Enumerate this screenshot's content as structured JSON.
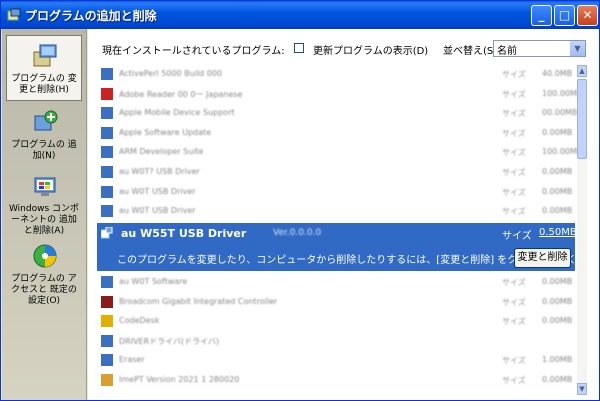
{
  "window": {
    "title": "プログラムの追加と削除",
    "buttons": {
      "minimize": "_",
      "maximize": "□",
      "close": "✕"
    }
  },
  "sidebar": {
    "items": [
      {
        "label": "プログラムの 変更と削除(H)",
        "icon": "change-remove-programs-icon"
      },
      {
        "label": "プログラムの 追加(N)",
        "icon": "add-programs-icon"
      },
      {
        "label": "Windows コンポーネントの 追加と削除(A)",
        "icon": "windows-components-icon"
      },
      {
        "label": "プログラムの アクセスと 既定の設定(O)",
        "icon": "program-access-defaults-icon"
      }
    ]
  },
  "header": {
    "installed_label": "現在インストールされているプログラム:",
    "show_updates_label": "更新プログラムの表示(D)",
    "show_updates_checked": false,
    "sort_label": "並べ替え(S):",
    "sort_value": "名前"
  },
  "programs_above": [
    {
      "name": "ActivePerl 5000 Build 000",
      "size_label": "サイズ",
      "size": "40.0MB",
      "icon_color": "#3a6fc4"
    },
    {
      "name": "Adobe Reader 00 0一 Japanese",
      "size_label": "サイズ",
      "size": "100.00MB",
      "icon_color": "#c22"
    },
    {
      "name": "Apple Mobile Device Support",
      "size_label": "サイズ",
      "size": "00.00MB",
      "icon_color": "#3a6fc4"
    },
    {
      "name": "Apple Software Update",
      "size_label": "サイズ",
      "size": "0.00MB",
      "icon_color": "#3a6fc4"
    },
    {
      "name": "ARM Developer Suite",
      "size_label": "サイズ",
      "size": "100.00MB",
      "icon_color": "#3a6fc4"
    },
    {
      "name": "au W0T? USB Driver",
      "size_label": "サイズ",
      "size": "0.00MB",
      "icon_color": "#3a6fc4"
    },
    {
      "name": "au W0T USB Driver",
      "size_label": "サイズ",
      "size": "0.00MB",
      "icon_color": "#3a6fc4"
    },
    {
      "name": "au W0T USB Driver",
      "size_label": "サイズ",
      "size": "0.00MB",
      "icon_color": "#3a6fc4"
    }
  ],
  "selected_program": {
    "name": "au W55T USB Driver",
    "version": "Ver.0.0.0.0",
    "size_label": "サイズ",
    "size": "0.50MB",
    "description": "このプログラムを変更したり、コンピュータから削除したりするには、[変更と削除] をクリックしてください。",
    "change_button": "変更と削除"
  },
  "programs_below": [
    {
      "name": "au W0T Software",
      "size_label": "サイズ",
      "size": "0.00MB",
      "icon_color": "#3a6fc4"
    },
    {
      "name": "Broadcom Gigabit Integrated Controller",
      "size_label": "サイズ",
      "size": "0.00MB",
      "icon_color": "#8b1a1a"
    },
    {
      "name": "CodeDesk",
      "size_label": "サイズ",
      "size": "0.00MB",
      "icon_color": "#e0b000"
    },
    {
      "name": "DRIVERドライバ(ドライバ)",
      "size_label": "",
      "size": "",
      "icon_color": "#3a6fc4"
    },
    {
      "name": "Eraser",
      "size_label": "サイズ",
      "size": "1.00MB",
      "icon_color": "#3a6fc4"
    },
    {
      "name": "ImePT Version 2021 1 280020",
      "size_label": "サイズ",
      "size": "0.00MB",
      "icon_color": "#d9a030"
    }
  ],
  "colors": {
    "title_blue": "#0054e3",
    "selection_blue": "#316ac5",
    "sidebar_bg": "#c8c5b3"
  }
}
